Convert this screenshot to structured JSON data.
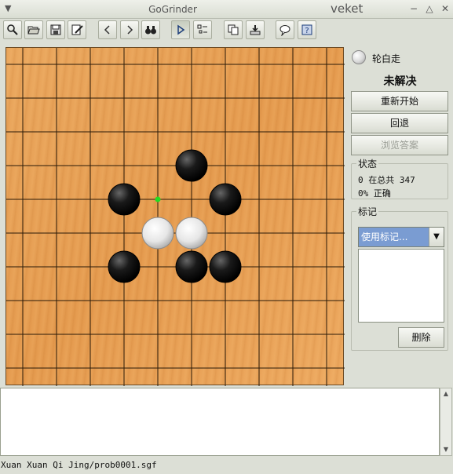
{
  "window": {
    "title": "GoGrinder",
    "user": "veket",
    "buttons": [
      "minimize-icon",
      "maximize-icon",
      "close-icon"
    ]
  },
  "toolbar": {
    "buttons": [
      {
        "name": "search-button",
        "icon": "magnifier-icon"
      },
      {
        "name": "open-button",
        "icon": "folder-open-icon"
      },
      {
        "name": "save-button",
        "icon": "floppy-disk-icon"
      },
      {
        "name": "edit-button",
        "icon": "pencil-note-icon"
      },
      {
        "name": "previous-button",
        "icon": "chevron-left-icon"
      },
      {
        "name": "next-button",
        "icon": "chevron-right-icon"
      },
      {
        "name": "find-button",
        "icon": "binoculars-icon"
      },
      {
        "name": "play-button",
        "icon": "play-icon",
        "active": true
      },
      {
        "name": "list-button",
        "icon": "list-icon"
      },
      {
        "name": "copy-button",
        "icon": "copy-icon"
      },
      {
        "name": "import-button",
        "icon": "tray-download-icon"
      },
      {
        "name": "comment-button",
        "icon": "speech-bubble-icon"
      },
      {
        "name": "help-button",
        "icon": "question-mark-icon"
      }
    ]
  },
  "board": {
    "lines": 10,
    "last_move_marker": {
      "col": 4,
      "row": 4,
      "color": "#22dd22"
    },
    "stones": [
      {
        "col": 5,
        "row": 3,
        "color": "black"
      },
      {
        "col": 3,
        "row": 4,
        "color": "black"
      },
      {
        "col": 6,
        "row": 4,
        "color": "black"
      },
      {
        "col": 4,
        "row": 5,
        "color": "white"
      },
      {
        "col": 5,
        "row": 5,
        "color": "white"
      },
      {
        "col": 3,
        "row": 6,
        "color": "black"
      },
      {
        "col": 5,
        "row": 6,
        "color": "black"
      },
      {
        "col": 6,
        "row": 6,
        "color": "black"
      }
    ]
  },
  "panel": {
    "turn_label": "轮白走",
    "problem_status": "未解决",
    "restart_label": "重新开始",
    "undo_label": "回退",
    "browse_answer_label": "浏览答案",
    "status": {
      "title": "状态",
      "progress_text": "0 在总共 347",
      "correct_text": "0% 正确"
    },
    "marks": {
      "title": "标记",
      "selected": "使用标记...",
      "delete_label": "删除"
    }
  },
  "comment_text": "",
  "statusbar": {
    "path": "Xuan Xuan Qi Jing/prob0001.sgf"
  },
  "colors": {
    "board": "#e59b4f",
    "grid": "#2a1a08",
    "selection": "#7a9cd2"
  }
}
